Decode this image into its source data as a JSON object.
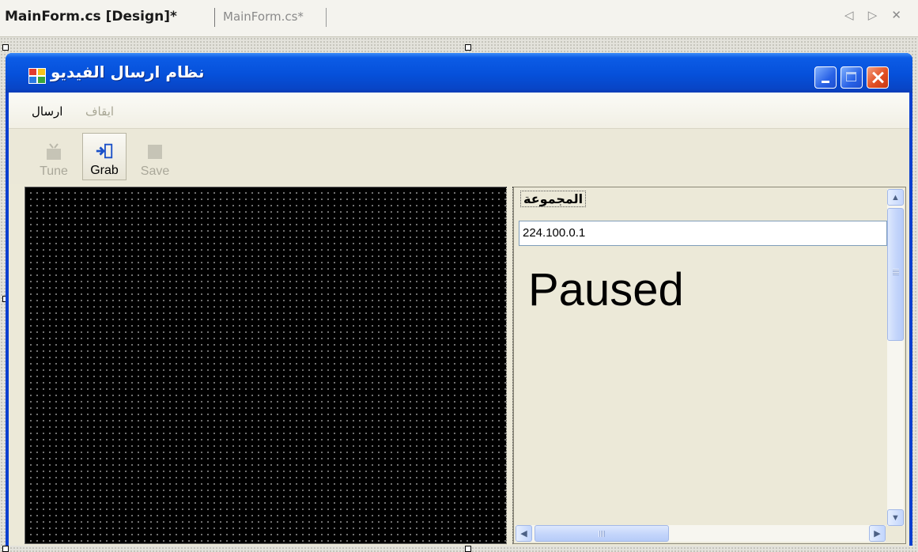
{
  "document_tabs": {
    "active": "MainForm.cs [Design]*",
    "inactive": "MainForm.cs*",
    "nav_glyphs": "◁ ▷ ✕"
  },
  "form": {
    "title": "نظام ارسال الفيديو",
    "icon": "app-form-icon"
  },
  "menu": {
    "send": "ارسال",
    "stop": "ايقاف"
  },
  "toolbar": {
    "tune": "Tune",
    "grab": "Grab",
    "save": "Save"
  },
  "panel": {
    "group_label": "المجموعة",
    "group_value": "224.100.0.1",
    "status": "Paused"
  },
  "scrollbar_glyphs": {
    "up": "▲",
    "down": "▼",
    "left": "◀",
    "right": "▶"
  },
  "colors": {
    "titlebar": "#0650da",
    "client_bg": "#ece9d8",
    "video_bg": "#000000"
  }
}
